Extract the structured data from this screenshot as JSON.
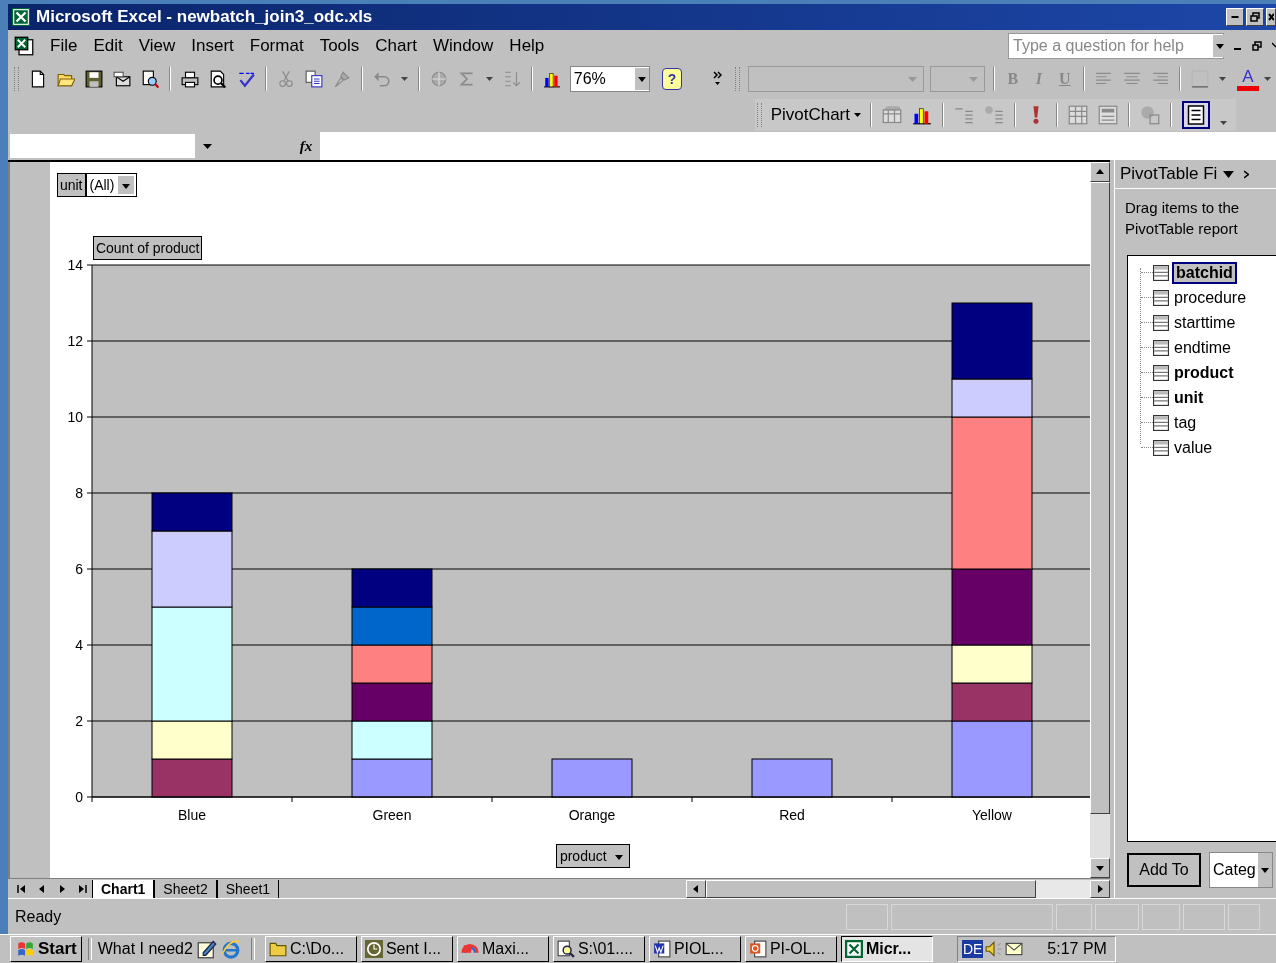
{
  "window": {
    "title": "Microsoft Excel - newbatch_join3_odc.xls"
  },
  "menu_bar": {
    "items": [
      "File",
      "Edit",
      "View",
      "Insert",
      "Format",
      "Tools",
      "Chart",
      "Window",
      "Help"
    ],
    "help_search": {
      "placeholder": "Type a question for help"
    }
  },
  "standard_toolbar": {
    "zoom": "76%",
    "help_button": "?"
  },
  "formatting_toolbar": {
    "buttons": [
      "B",
      "I",
      "U"
    ],
    "font_color": "A"
  },
  "pivotchart_toolbar": {
    "menu": "PivotChart"
  },
  "formula_bar": {
    "function_label": "fx"
  },
  "chart": {
    "page_field": {
      "name": "unit",
      "value": "(All)"
    },
    "data_field": "Count of product",
    "category_field": "product",
    "chart_data": {
      "type": "bar",
      "stacked": true,
      "grid": true,
      "categories": [
        "Blue",
        "Green",
        "Orange",
        "Red",
        "Yellow"
      ],
      "ylim": [
        0,
        14
      ],
      "yticks": [
        0,
        2,
        4,
        6,
        8,
        10,
        12,
        14
      ],
      "series": [
        {
          "color": "#9999ff",
          "values": [
            null,
            1,
            1,
            1,
            2
          ]
        },
        {
          "color": "#993366",
          "values": [
            1,
            null,
            null,
            null,
            1
          ]
        },
        {
          "color": "#ffffcc",
          "values": [
            1,
            null,
            null,
            null,
            1
          ]
        },
        {
          "color": "#ccffff",
          "values": [
            3,
            1,
            null,
            null,
            null
          ]
        },
        {
          "color": "#660066",
          "values": [
            null,
            1,
            null,
            null,
            2
          ]
        },
        {
          "color": "#ff8080",
          "values": [
            null,
            1,
            null,
            null,
            4
          ]
        },
        {
          "color": "#0066cc",
          "values": [
            null,
            1,
            null,
            null,
            null
          ]
        },
        {
          "color": "#ccccff",
          "values": [
            2,
            null,
            null,
            null,
            1
          ]
        },
        {
          "color": "#000080",
          "values": [
            1,
            1,
            null,
            null,
            2
          ]
        }
      ]
    }
  },
  "task_pane": {
    "title": "PivotTable Fi",
    "hint": "Drag items to the PivotTable report",
    "fields": [
      {
        "label": "batchid",
        "in_use": true,
        "selected": true
      },
      {
        "label": "procedure",
        "in_use": false,
        "selected": false
      },
      {
        "label": "starttime",
        "in_use": false,
        "selected": false
      },
      {
        "label": "endtime",
        "in_use": false,
        "selected": false
      },
      {
        "label": "product",
        "in_use": true,
        "selected": false
      },
      {
        "label": "unit",
        "in_use": true,
        "selected": false
      },
      {
        "label": "tag",
        "in_use": false,
        "selected": false
      },
      {
        "label": "value",
        "in_use": false,
        "selected": false
      }
    ],
    "add_button": "Add To",
    "area_dropdown": "Categ"
  },
  "sheet_tabs": [
    {
      "label": "Chart1",
      "selected": true
    },
    {
      "label": "Sheet2",
      "selected": false
    },
    {
      "label": "Sheet1",
      "selected": false
    }
  ],
  "status_bar": {
    "text": "Ready"
  },
  "taskbar": {
    "start": "Start",
    "toolbar_label": "What I need2",
    "tasks": [
      {
        "label": "C:\\Do...",
        "active": false
      },
      {
        "label": "Sent I...",
        "active": false
      },
      {
        "label": "Maxi...",
        "active": false
      },
      {
        "label": "S:\\01....",
        "active": false
      },
      {
        "label": "PIOL...",
        "active": false
      },
      {
        "label": "PI-OL...",
        "active": false
      },
      {
        "label": "Micr...",
        "active": true
      }
    ],
    "tray": {
      "language": "DE",
      "clock": "5:17 PM"
    }
  }
}
